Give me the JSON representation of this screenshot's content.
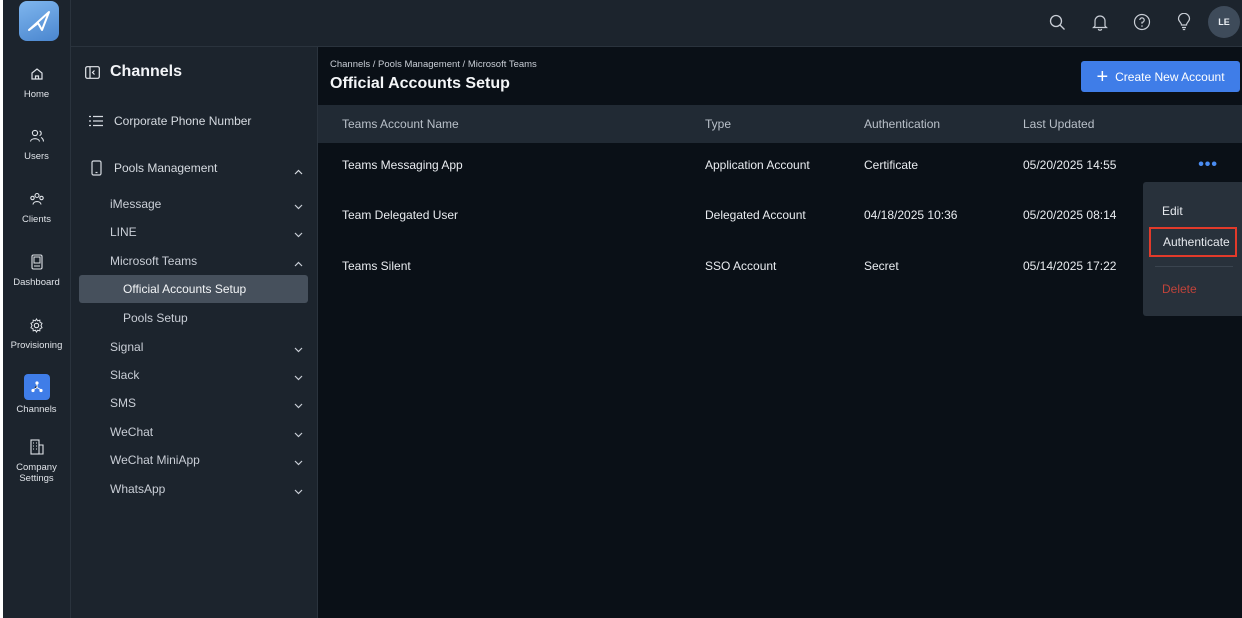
{
  "rail": {
    "items": [
      {
        "label": "Home",
        "icon": "home-icon"
      },
      {
        "label": "Users",
        "icon": "users-icon"
      },
      {
        "label": "Clients",
        "icon": "clients-icon"
      },
      {
        "label": "Dashboard",
        "icon": "dashboard-icon"
      },
      {
        "label": "Provisioning",
        "icon": "gear-icon"
      },
      {
        "label": "Channels",
        "icon": "channels-icon"
      },
      {
        "label": "Company Settings",
        "icon": "building-icon"
      }
    ]
  },
  "topbar": {
    "avatar_initials": "LE"
  },
  "sidebar": {
    "title": "Channels",
    "corporate": "Corporate Phone Number",
    "pools": "Pools Management",
    "sub": [
      "iMessage",
      "LINE",
      "Microsoft Teams",
      "Signal",
      "Slack",
      "SMS",
      "WeChat",
      "WeChat MiniApp",
      "WhatsApp"
    ],
    "teams_children": [
      "Official Accounts Setup",
      "Pools Setup"
    ]
  },
  "main": {
    "breadcrumb": "Channels / Pools Management / Microsoft Teams",
    "title": "Official Accounts Setup",
    "create_label": "Create New Account",
    "columns": [
      "Teams Account Name",
      "Type",
      "Authentication",
      "Last Updated"
    ],
    "rows": [
      [
        "Teams Messaging App",
        "Application Account",
        "Certificate",
        "05/20/2025 14:55"
      ],
      [
        "Team Delegated User",
        "Delegated Account",
        "04/18/2025 10:36",
        "05/20/2025 08:14"
      ],
      [
        "Teams Silent",
        "SSO Account",
        "Secret",
        "05/14/2025 17:22"
      ]
    ],
    "more": "•••"
  },
  "menu": {
    "edit": "Edit",
    "authenticate": "Authenticate",
    "delete": "Delete"
  },
  "colors": {
    "accent": "#3f7de8",
    "highlight": "#e23a2a",
    "delete": "#c0433a"
  }
}
